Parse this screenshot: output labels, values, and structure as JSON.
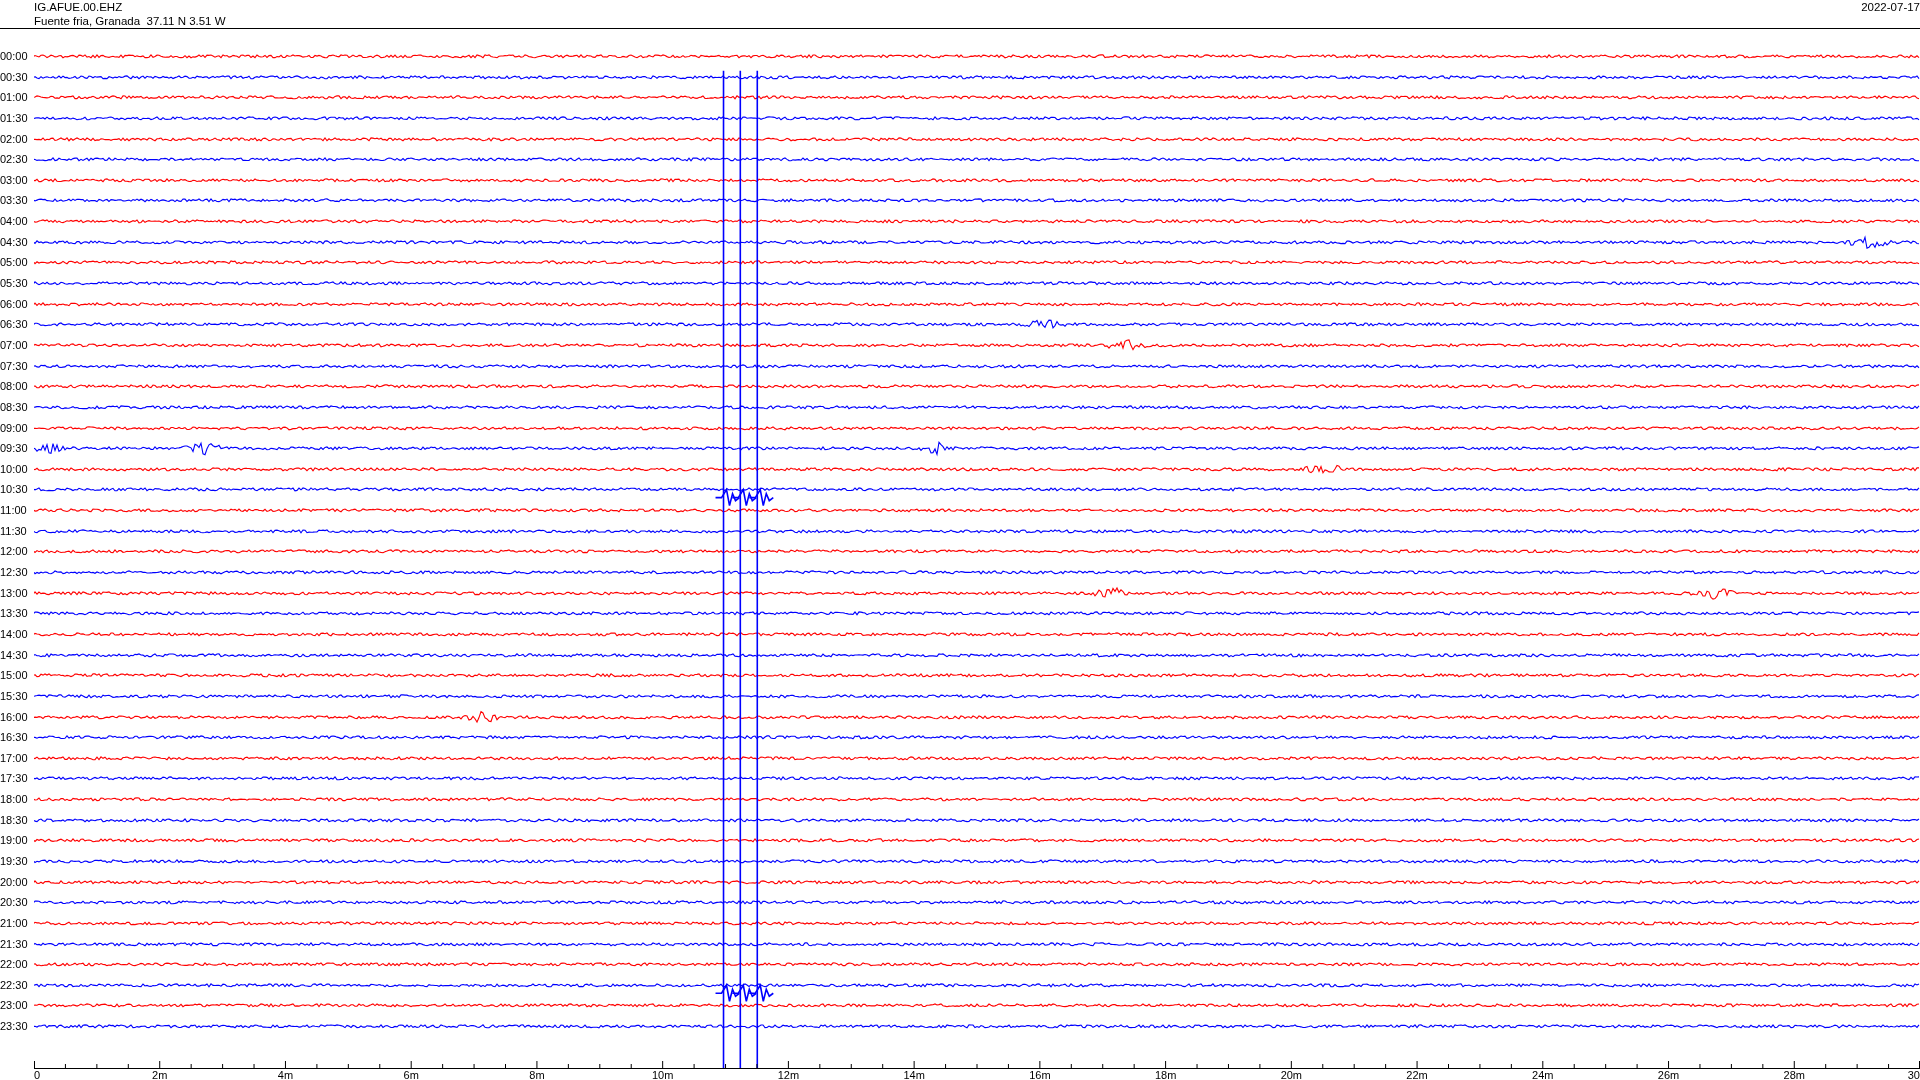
{
  "header": {
    "station": "IG.AFUE.00.EHZ",
    "location": "Fuente fria, Granada  37.11 N 3.51 W",
    "date": "2022-07-17"
  },
  "rows": [
    {
      "time": "00:00",
      "color": "#ff0000"
    },
    {
      "time": "00:30",
      "color": "#0000ff"
    },
    {
      "time": "01:00",
      "color": "#ff0000"
    },
    {
      "time": "01:30",
      "color": "#0000ff"
    },
    {
      "time": "02:00",
      "color": "#ff0000"
    },
    {
      "time": "02:30",
      "color": "#0000ff"
    },
    {
      "time": "03:00",
      "color": "#ff0000"
    },
    {
      "time": "03:30",
      "color": "#0000ff"
    },
    {
      "time": "04:00",
      "color": "#ff0000"
    },
    {
      "time": "04:30",
      "color": "#0000ff"
    },
    {
      "time": "05:00",
      "color": "#ff0000"
    },
    {
      "time": "05:30",
      "color": "#0000ff"
    },
    {
      "time": "06:00",
      "color": "#ff0000"
    },
    {
      "time": "06:30",
      "color": "#0000ff"
    },
    {
      "time": "07:00",
      "color": "#ff0000"
    },
    {
      "time": "07:30",
      "color": "#0000ff"
    },
    {
      "time": "08:00",
      "color": "#ff0000"
    },
    {
      "time": "08:30",
      "color": "#0000ff"
    },
    {
      "time": "09:00",
      "color": "#ff0000"
    },
    {
      "time": "09:30",
      "color": "#0000ff"
    },
    {
      "time": "10:00",
      "color": "#ff0000"
    },
    {
      "time": "10:30",
      "color": "#0000ff"
    },
    {
      "time": "11:00",
      "color": "#ff0000"
    },
    {
      "time": "11:30",
      "color": "#0000ff"
    },
    {
      "time": "12:00",
      "color": "#ff0000"
    },
    {
      "time": "12:30",
      "color": "#0000ff"
    },
    {
      "time": "13:00",
      "color": "#ff0000"
    },
    {
      "time": "13:30",
      "color": "#0000ff"
    },
    {
      "time": "14:00",
      "color": "#ff0000"
    },
    {
      "time": "14:30",
      "color": "#0000ff"
    },
    {
      "time": "15:00",
      "color": "#ff0000"
    },
    {
      "time": "15:30",
      "color": "#0000ff"
    },
    {
      "time": "16:00",
      "color": "#ff0000"
    },
    {
      "time": "16:30",
      "color": "#0000ff"
    },
    {
      "time": "17:00",
      "color": "#ff0000"
    },
    {
      "time": "17:30",
      "color": "#0000ff"
    },
    {
      "time": "18:00",
      "color": "#ff0000"
    },
    {
      "time": "18:30",
      "color": "#0000ff"
    },
    {
      "time": "19:00",
      "color": "#ff0000"
    },
    {
      "time": "19:30",
      "color": "#0000ff"
    },
    {
      "time": "20:00",
      "color": "#ff0000"
    },
    {
      "time": "20:30",
      "color": "#0000ff"
    },
    {
      "time": "21:00",
      "color": "#ff0000"
    },
    {
      "time": "21:30",
      "color": "#0000ff"
    },
    {
      "time": "22:00",
      "color": "#ff0000"
    },
    {
      "time": "22:30",
      "color": "#0000ff"
    },
    {
      "time": "23:00",
      "color": "#ff0000"
    },
    {
      "time": "23:30",
      "color": "#0000ff"
    }
  ],
  "x_axis_labels": [
    "0",
    "2m",
    "4m",
    "6m",
    "8m",
    "10m",
    "12m",
    "14m",
    "16m",
    "18m",
    "20m",
    "22m",
    "24m",
    "26m",
    "28m",
    "30"
  ]
}
